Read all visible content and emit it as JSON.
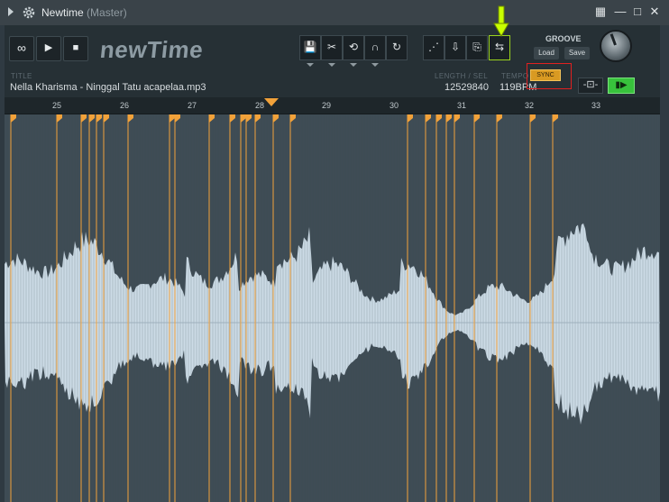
{
  "window": {
    "title": "Newtime",
    "subtitle": "(Master)",
    "buttons": [
      "▦",
      "—",
      "□",
      "✕"
    ]
  },
  "transport": {
    "loop_label": "∞",
    "play_label": "▶",
    "stop_label": "■"
  },
  "logo": {
    "text": "newTime"
  },
  "tools": [
    "💾",
    "✂",
    "⟲",
    "∩",
    "↻"
  ],
  "tools2": [
    "⋰",
    "⇩",
    "⎘",
    "⇆"
  ],
  "info": {
    "title_label": "TITLE",
    "title_value": "Nella Kharisma - Ninggal Tatu acapelaa.mp3",
    "length_label": "LENGTH / SEL",
    "length_value": "12529840",
    "tempo_label": "TEMPO",
    "tempo_value": "119BPM",
    "sync_label": "SYNC"
  },
  "groove": {
    "label": "GROOVE",
    "load": "Load",
    "save": "Save"
  },
  "controls": {
    "chain_label": "-⊡-",
    "play_label": "▮▶"
  },
  "ruler": {
    "bars": [
      "25",
      "26",
      "27",
      "28",
      "29",
      "30",
      "31",
      "32",
      "33"
    ]
  },
  "colors": {
    "accent": "#f2a23a",
    "waveform": "#ccdbe6",
    "background": "#3f4c55",
    "slice_marker": "#f2a23a",
    "annotation_arrow": "#c8ff00",
    "annotation_box": "#e02020"
  }
}
